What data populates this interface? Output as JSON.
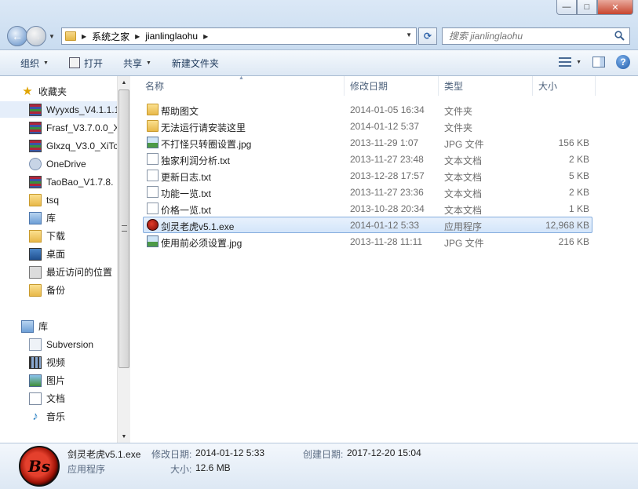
{
  "window": {
    "minimize_label": "—",
    "maximize_label": "□",
    "close_label": "✕"
  },
  "address": {
    "crumbs": [
      "系统之家",
      "jianlinglaohu"
    ]
  },
  "search": {
    "placeholder": "搜索 jianlinglaohu"
  },
  "toolbar": {
    "organize": "组织",
    "open": "打开",
    "share": "共享",
    "new_folder": "新建文件夹"
  },
  "nav": {
    "favorites": "收藏夹",
    "items": [
      {
        "label": "Wyyxds_V4.1.1.1",
        "icon": "rar-icon"
      },
      {
        "label": "Frasf_V3.7.0.0_X",
        "icon": "rar-icon"
      },
      {
        "label": "Glxzq_V3.0_XiTc",
        "icon": "rar-icon"
      },
      {
        "label": "OneDrive",
        "icon": "cloud-icon"
      },
      {
        "label": "TaoBao_V1.7.8.",
        "icon": "rar-icon"
      },
      {
        "label": "tsq",
        "icon": "folder-icon"
      },
      {
        "label": "库",
        "icon": "library-icon"
      },
      {
        "label": "下载",
        "icon": "download-icon"
      },
      {
        "label": "桌面",
        "icon": "desktop-icon"
      },
      {
        "label": "最近访问的位置",
        "icon": "recent-icon"
      },
      {
        "label": "备份",
        "icon": "folder-icon"
      }
    ],
    "libraries": "库",
    "library_items": [
      {
        "label": "Subversion",
        "icon": "svn-icon"
      },
      {
        "label": "视频",
        "icon": "video-icon"
      },
      {
        "label": "图片",
        "icon": "picture-icon"
      },
      {
        "label": "文档",
        "icon": "document-icon"
      },
      {
        "label": "音乐",
        "icon": "music-icon"
      }
    ]
  },
  "columns": {
    "name": "名称",
    "modified": "修改日期",
    "type": "类型",
    "size": "大小"
  },
  "files": [
    {
      "name": "帮助图文",
      "modified": "2014-01-05 16:34",
      "type": "文件夹",
      "size": "",
      "icon": "folder-icon"
    },
    {
      "name": "无法运行请安装这里",
      "modified": "2014-01-12 5:37",
      "type": "文件夹",
      "size": "",
      "icon": "folder-icon"
    },
    {
      "name": "不打怪只转圈设置.jpg",
      "modified": "2013-11-29 1:07",
      "type": "JPG 文件",
      "size": "156 KB",
      "icon": "jpg-icon"
    },
    {
      "name": "独家利润分析.txt",
      "modified": "2013-11-27 23:48",
      "type": "文本文档",
      "size": "2 KB",
      "icon": "txt-icon"
    },
    {
      "name": "更新日志.txt",
      "modified": "2013-12-28 17:57",
      "type": "文本文档",
      "size": "5 KB",
      "icon": "txt-icon"
    },
    {
      "name": "功能一览.txt",
      "modified": "2013-11-27 23:36",
      "type": "文本文档",
      "size": "2 KB",
      "icon": "txt-icon"
    },
    {
      "name": "价格一览.txt",
      "modified": "2013-10-28 20:34",
      "type": "文本文档",
      "size": "1 KB",
      "icon": "txt-icon"
    },
    {
      "name": "剑灵老虎v5.1.exe",
      "modified": "2014-01-12 5:33",
      "type": "应用程序",
      "size": "12,968 KB",
      "icon": "exe-icon",
      "selected": true
    },
    {
      "name": "使用前必须设置.jpg",
      "modified": "2013-11-28 11:11",
      "type": "JPG 文件",
      "size": "216 KB",
      "icon": "jpg-icon"
    }
  ],
  "details": {
    "filename": "剑灵老虎v5.1.exe",
    "type": "应用程序",
    "modified_label": "修改日期:",
    "modified_value": "2014-01-12 5:33",
    "created_label": "创建日期:",
    "created_value": "2017-12-20 15:04",
    "size_label": "大小:",
    "size_value": "12.6 MB",
    "icon_text": "Bs"
  }
}
